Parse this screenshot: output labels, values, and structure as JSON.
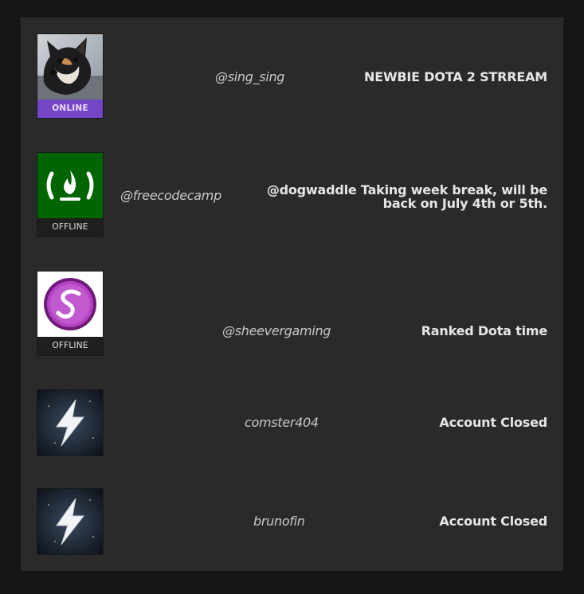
{
  "streams": [
    {
      "username": "@sing_sing",
      "status": "ONLINE",
      "title": "NEWBIE DOTA 2 STRREAM",
      "avatar_icon": "dog-photo-icon"
    },
    {
      "username": "@freecodecamp",
      "status": "OFFLINE",
      "title": "@dogwaddle Taking week break, will be back on July 4th or 5th.",
      "avatar_icon": "freecodecamp-logo-icon"
    },
    {
      "username": "@sheevergaming",
      "status": "OFFLINE",
      "title": "Ranked Dota time",
      "avatar_icon": "sheever-logo-icon"
    },
    {
      "username": "comster404",
      "status": "",
      "title": "Account Closed",
      "avatar_icon": "lightning-bolt-icon"
    },
    {
      "username": "brunofin",
      "status": "",
      "title": "Account Closed",
      "avatar_icon": "lightning-bolt-icon"
    }
  ],
  "colors": {
    "page_bg": "#161616",
    "panel_bg": "#2a2a2a",
    "online": "#7445c4",
    "freecodecamp_green": "#006400",
    "sheever_purple": "#9b2fa8"
  }
}
